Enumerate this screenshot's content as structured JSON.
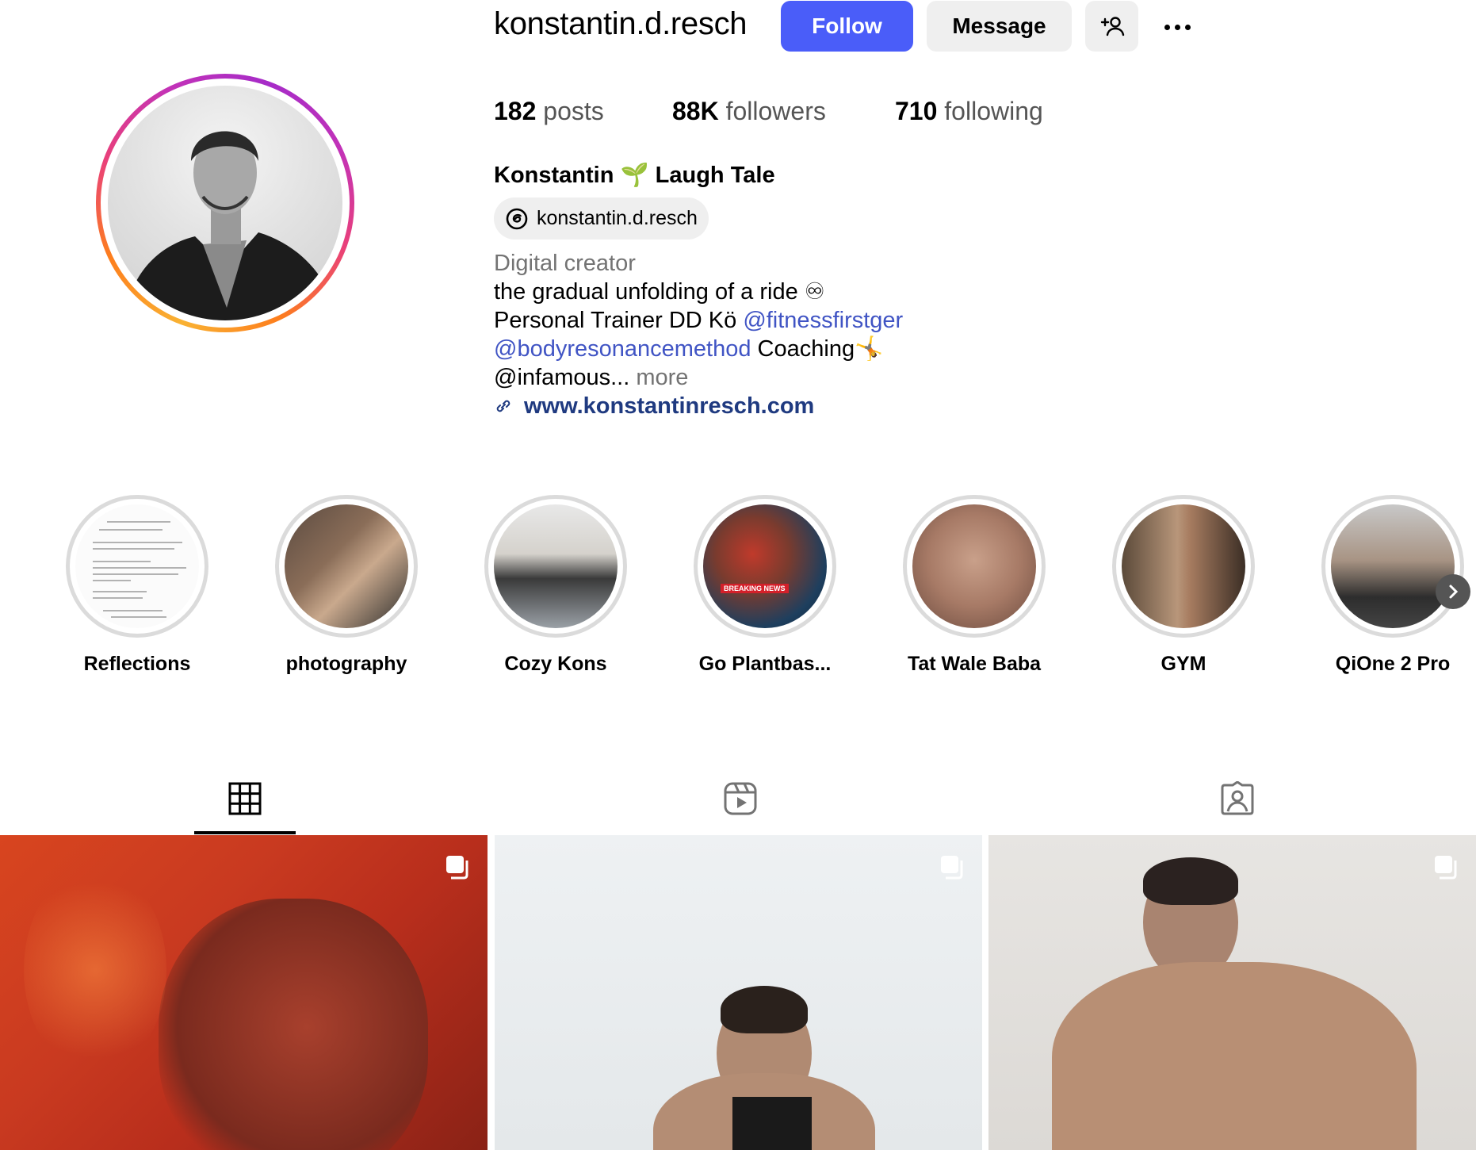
{
  "profile": {
    "username": "konstantin.d.resch",
    "follow_label": "Follow",
    "message_label": "Message",
    "posts_count": "182",
    "posts_label": "posts",
    "followers_count": "88K",
    "followers_label": "followers",
    "following_count": "710",
    "following_label": "following",
    "full_name": "Konstantin 🌱 Laugh Tale",
    "threads_handle": "konstantin.d.resch",
    "category": "Digital creator",
    "bio_line1": "the gradual unfolding of a ride ♾",
    "bio_line2_text": "Personal Trainer DD Kö ",
    "bio_line2_mention": "@fitnessfirstger",
    "bio_line3_mention": "@bodyresonancemethod",
    "bio_line3_text": " Coaching🤸",
    "bio_line4_text": "@infamous... ",
    "bio_more": "more",
    "website": "www.konstantinresch.com"
  },
  "highlights": [
    {
      "label": "Reflections"
    },
    {
      "label": "photography"
    },
    {
      "label": "Cozy Kons"
    },
    {
      "label": "Go Plantbas..."
    },
    {
      "label": "Tat Wale Baba"
    },
    {
      "label": "GYM"
    },
    {
      "label": "QiOne 2 Pro"
    }
  ],
  "highlight_news_overlay": "BREAKING NEWS",
  "tabs": [
    {
      "icon": "grid-icon",
      "active": true
    },
    {
      "icon": "reels-icon",
      "active": false
    },
    {
      "icon": "tagged-icon",
      "active": false
    }
  ],
  "colors": {
    "follow_button": "#4a5df9",
    "link": "#4054c4",
    "website": "#1f3a80"
  }
}
